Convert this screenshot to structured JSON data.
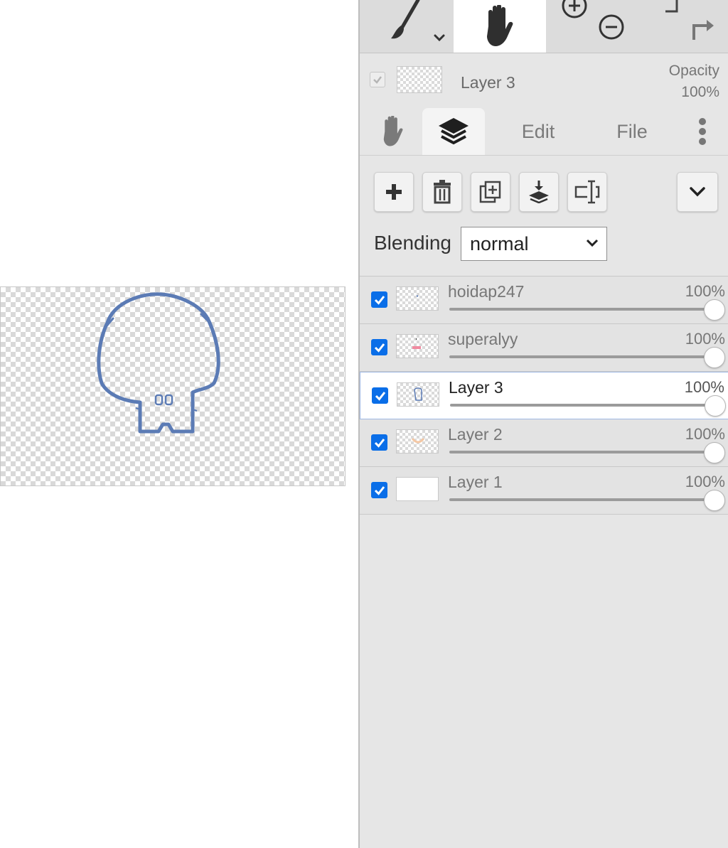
{
  "toolbar": {
    "tools": [
      {
        "name": "brush",
        "icon": "brush-icon"
      },
      {
        "name": "hand",
        "icon": "hand-icon",
        "active": true
      },
      {
        "name": "zoom",
        "icon": "zoom-in-out-icon"
      },
      {
        "name": "undo-redo",
        "icon": "undo-redo-icon"
      }
    ]
  },
  "current_layer": {
    "name": "Layer 3",
    "opacity_label": "Opacity",
    "opacity_value": "100%"
  },
  "tabs": {
    "hand_icon": "hand-icon",
    "layers_icon": "layers-icon",
    "edit": "Edit",
    "file": "File",
    "more_icon": "more-vertical-icon"
  },
  "layer_buttons": [
    "add-layer-icon",
    "delete-layer-icon",
    "duplicate-layer-icon",
    "merge-down-icon",
    "rename-layer-icon",
    "collapse-icon"
  ],
  "blending": {
    "label": "Blending",
    "value": "normal"
  },
  "layers": [
    {
      "name": "hoidap247",
      "opacity": "100%",
      "visible": true,
      "selected": false,
      "opacity_level": 1.0
    },
    {
      "name": "superalyy",
      "opacity": "100%",
      "visible": true,
      "selected": false,
      "opacity_level": 1.0
    },
    {
      "name": "Layer 3",
      "opacity": "100%",
      "visible": true,
      "selected": true,
      "opacity_level": 1.0
    },
    {
      "name": "Layer 2",
      "opacity": "100%",
      "visible": true,
      "selected": false,
      "opacity_level": 1.0
    },
    {
      "name": "Layer 1",
      "opacity": "100%",
      "visible": true,
      "selected": false,
      "opacity_level": 1.0
    }
  ],
  "colors": {
    "accent": "#0a6ee8",
    "drawing_stroke": "#5b7bb5",
    "panel_bg": "#e6e6e6"
  }
}
